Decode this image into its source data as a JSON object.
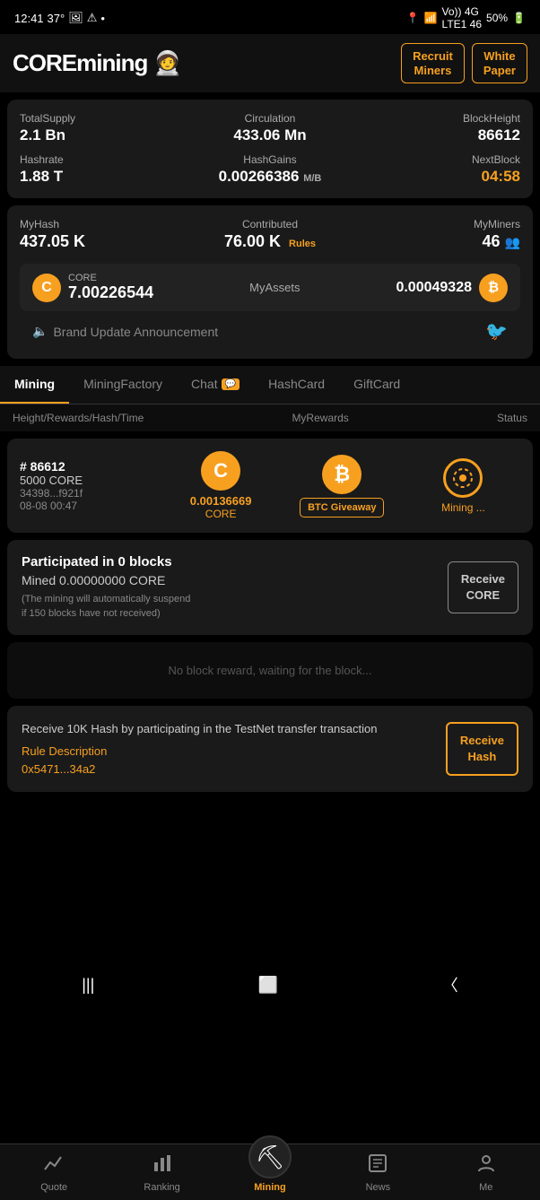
{
  "statusBar": {
    "time": "12:41",
    "temp": "37°",
    "battery": "50%",
    "signal": "4G"
  },
  "header": {
    "logoCore": "CORE",
    "logoMining": "mining",
    "logoEmoji": "🧑‍🚀",
    "recruitBtn": "Recruit\nMiners",
    "whitePaperBtn": "White\nPaper"
  },
  "stats": {
    "totalSupplyLabel": "TotalSupply",
    "totalSupplyValue": "2.1 Bn",
    "circulationLabel": "Circulation",
    "circulationValue": "433.06 Mn",
    "blockHeightLabel": "BlockHeight",
    "blockHeightValue": "86612",
    "hashrateLabel": "Hashrate",
    "hashrateValue": "1.88 T",
    "hashGainsLabel": "HashGains",
    "hashGainsValue": "0.00266386",
    "hashGainsUnit": "M/B",
    "nextBlockLabel": "NextBlock",
    "nextBlockValue": "04:58"
  },
  "myStats": {
    "myHashLabel": "MyHash",
    "myHashValue": "437.05 K",
    "contributedLabel": "Contributed",
    "contributedValue": "76.00 K",
    "rulesLink": "Rules",
    "myMinersLabel": "MyMiners",
    "myMinersValue": "46"
  },
  "assets": {
    "coreSymbol": "C",
    "coreLabel": "CORE",
    "coreValue": "7.00226544",
    "myAssetsLabel": "MyAssets",
    "btcValue": "0.00049328",
    "btcSymbol": "₿"
  },
  "announcement": {
    "icon": "🔈",
    "text": "Brand Update Announcement"
  },
  "tabs": [
    {
      "id": "mining",
      "label": "Mining",
      "active": true,
      "badge": ""
    },
    {
      "id": "miningfactory",
      "label": "MiningFactory",
      "active": false,
      "badge": ""
    },
    {
      "id": "chat",
      "label": "Chat",
      "active": false,
      "badge": "💬"
    },
    {
      "id": "hashcard",
      "label": "HashCard",
      "active": false,
      "badge": ""
    },
    {
      "id": "giftcard",
      "label": "GiftCard",
      "active": false,
      "badge": ""
    }
  ],
  "tableHeader": {
    "col1": "Height/Rewards/Hash/Time",
    "col2": "MyRewards",
    "col3": "Status"
  },
  "miningRow": {
    "blockNum": "# 86612",
    "blockReward": "5000 CORE",
    "blockHash": "34398...f921f",
    "blockTime": "08-08 00:47",
    "coreRewardValue": "0.00136669",
    "coreRewardLabel": "CORE",
    "btcGiveawayBtn": "BTC Giveaway",
    "miningStatus": "Mining ..."
  },
  "participated": {
    "title": "Participated in 0 blocks",
    "mined": "Mined 0.00000000 CORE",
    "note": "(The mining will automatically suspend\nif 150 blocks have not received)",
    "receiveBtn": "Receive\nCORE"
  },
  "noReward": {
    "message": "No block reward, waiting for the block..."
  },
  "hashPromo": {
    "description": "Receive 10K Hash by participating in the TestNet transfer transaction",
    "ruleLink": "Rule Description",
    "address": "0x5471...34a2",
    "receiveBtn": "Receive\nHash"
  },
  "bottomNav": [
    {
      "id": "quote",
      "label": "Quote",
      "icon": "📈",
      "active": false
    },
    {
      "id": "ranking",
      "label": "Ranking",
      "icon": "📊",
      "active": false
    },
    {
      "id": "mining",
      "label": "Mining",
      "icon": "⛏",
      "active": true,
      "special": true
    },
    {
      "id": "news",
      "label": "News",
      "icon": "📰",
      "active": false
    },
    {
      "id": "me",
      "label": "Me",
      "icon": "👤",
      "active": false
    }
  ]
}
